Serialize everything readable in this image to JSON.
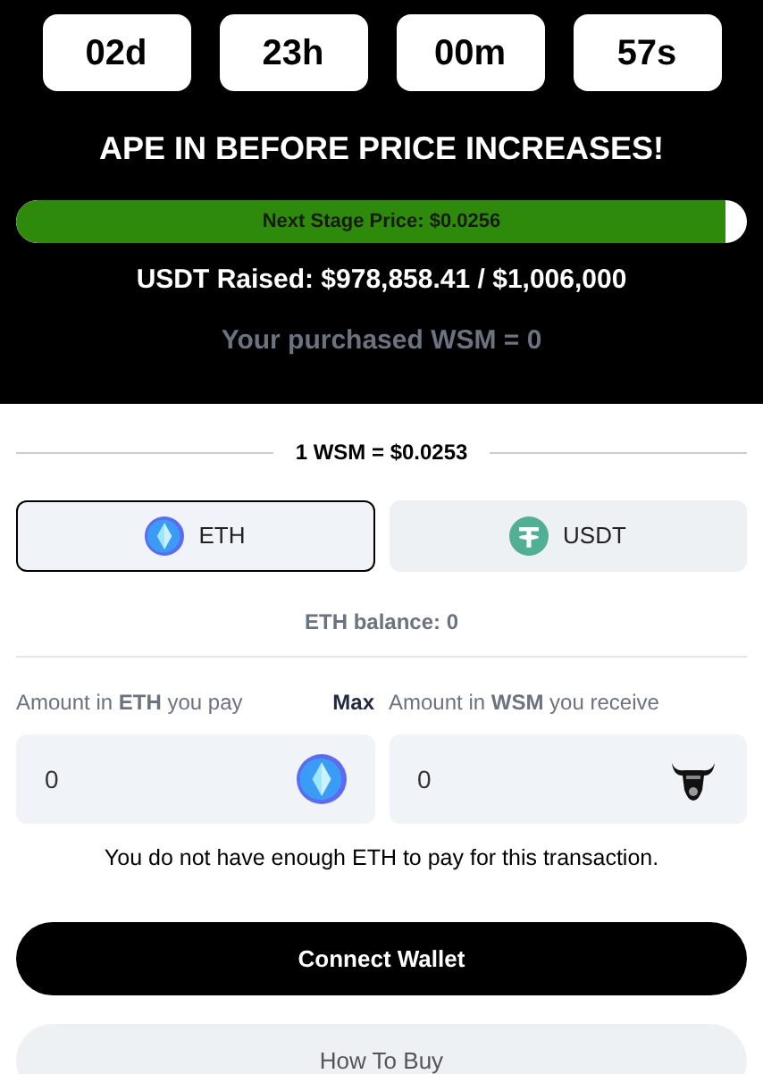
{
  "countdown": [
    {
      "value": "02d"
    },
    {
      "value": "23h"
    },
    {
      "value": "00m"
    },
    {
      "value": "57s"
    }
  ],
  "headline": "APE IN BEFORE PRICE INCREASES!",
  "progress": {
    "label": "Next Stage Price: $0.0256",
    "level": 0.97
  },
  "raised": "USDT Raised: $978,858.41 / $1,006,000",
  "purchased": "Your purchased WSM = 0",
  "rate": "1 WSM = $0.0253",
  "currency_tabs": [
    {
      "label": "ETH",
      "kind": "eth",
      "selected": true
    },
    {
      "label": "USDT",
      "kind": "usdt",
      "selected": false
    }
  ],
  "balance": "ETH balance: 0",
  "pay": {
    "label": "Amount in **ETH** you pay",
    "max": "Max",
    "value": "0"
  },
  "receive": {
    "label": "Amount in **WSM** you receive",
    "value": "0"
  },
  "warning": "You do not have enough ETH to pay for this transaction.",
  "buttons": [
    {
      "label": "Connect Wallet",
      "kind": "primary"
    },
    {
      "label": "How To Buy",
      "kind": "secondary"
    }
  ]
}
